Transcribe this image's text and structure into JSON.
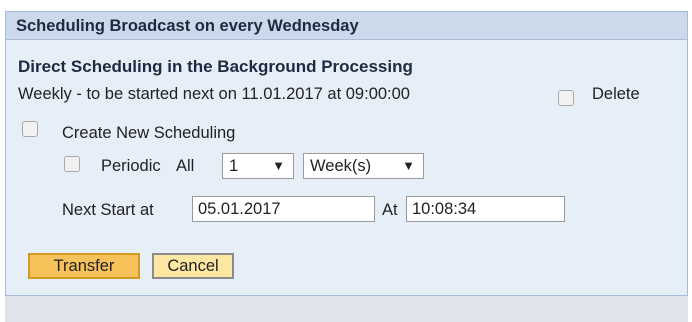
{
  "title": "Scheduling Broadcast on every Wednesday",
  "section": {
    "heading": "Direct Scheduling in the Background Processing",
    "status_text": "Weekly - to be started next on 11.01.2017 at 09:00:00",
    "delete_label": "Delete"
  },
  "create_new": {
    "label": "Create New Scheduling"
  },
  "periodic": {
    "label": "Periodic",
    "all_label": "All",
    "count_value": "1",
    "unit_value": "Week(s)",
    "arrow": "▼"
  },
  "next_start": {
    "label": "Next Start at",
    "date_value": "05.01.2017",
    "at_label": "At",
    "time_value": "10:08:34"
  },
  "buttons": {
    "transfer": "Transfer",
    "cancel": "Cancel"
  }
}
